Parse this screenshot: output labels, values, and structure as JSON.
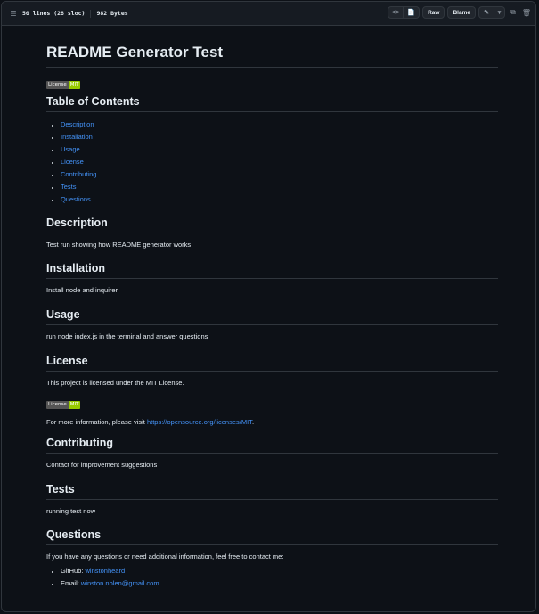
{
  "toolbar": {
    "lines_label": "50 lines (28 sloc)",
    "bytes_label": "982 Bytes",
    "raw_label": "Raw",
    "blame_label": "Blame"
  },
  "readme": {
    "title": "README Generator Test",
    "badge": {
      "left": "License",
      "right": "MIT",
      "color": "#97ca00"
    },
    "toc_heading": "Table of Contents",
    "toc": [
      "Description",
      "Installation",
      "Usage",
      "License",
      "Contributing",
      "Tests",
      "Questions"
    ],
    "description": {
      "heading": "Description",
      "text": "Test run showing how README generator works"
    },
    "installation": {
      "heading": "Installation",
      "text": "Install node and inquirer"
    },
    "usage": {
      "heading": "Usage",
      "text": "run node index.js in the terminal and answer questions"
    },
    "license": {
      "heading": "License",
      "text": "This project is licensed under the MIT License.",
      "more_prefix": "For more information, please visit ",
      "more_link": "https://opensource.org/licenses/MIT",
      "more_suffix": "."
    },
    "contributing": {
      "heading": "Contributing",
      "text": "Contact for improvement suggestions"
    },
    "tests": {
      "heading": "Tests",
      "text": "running test now"
    },
    "questions": {
      "heading": "Questions",
      "text": "If you have any questions or need additional information, feel free to contact me:",
      "github_label": "GitHub: ",
      "github_user": "winstonheard",
      "email_label": "Email: ",
      "email": "winston.nolen@gmail.com"
    }
  },
  "colors": {
    "background": "#0d1117",
    "link": "#4493f8",
    "border": "#30363d"
  }
}
